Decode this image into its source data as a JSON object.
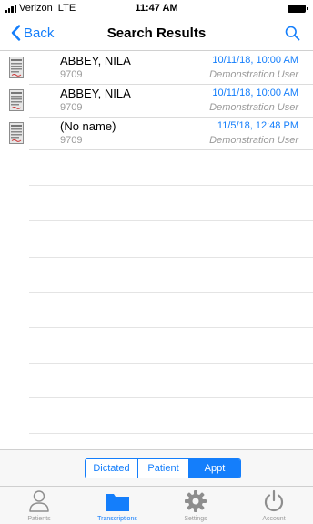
{
  "status_bar": {
    "carrier": "Verizon  LTE",
    "time": "11:47 AM"
  },
  "nav": {
    "back_label": "Back",
    "title": "Search Results"
  },
  "results": [
    {
      "name": "ABBEY, NILA",
      "id": "9709",
      "date": "10/11/18, 10:00 AM",
      "user": "Demonstration User"
    },
    {
      "name": "ABBEY, NILA",
      "id": "9709",
      "date": "10/11/18, 10:00 AM",
      "user": "Demonstration User"
    },
    {
      "name": "(No name)",
      "id": "9709",
      "date": "11/5/18, 12:48 PM",
      "user": "Demonstration User"
    }
  ],
  "segments": {
    "items": [
      "Dictated",
      "Patient",
      "Appt"
    ],
    "selected": "Appt"
  },
  "tabs": [
    {
      "label": "Patients",
      "icon": "person-icon"
    },
    {
      "label": "Transcriptions",
      "icon": "folder-icon"
    },
    {
      "label": "Settings",
      "icon": "gear-icon"
    },
    {
      "label": "Account",
      "icon": "power-icon"
    }
  ],
  "selected_tab": "Transcriptions",
  "colors": {
    "accent": "#147efb",
    "secondary_text": "#9a9a9a"
  }
}
